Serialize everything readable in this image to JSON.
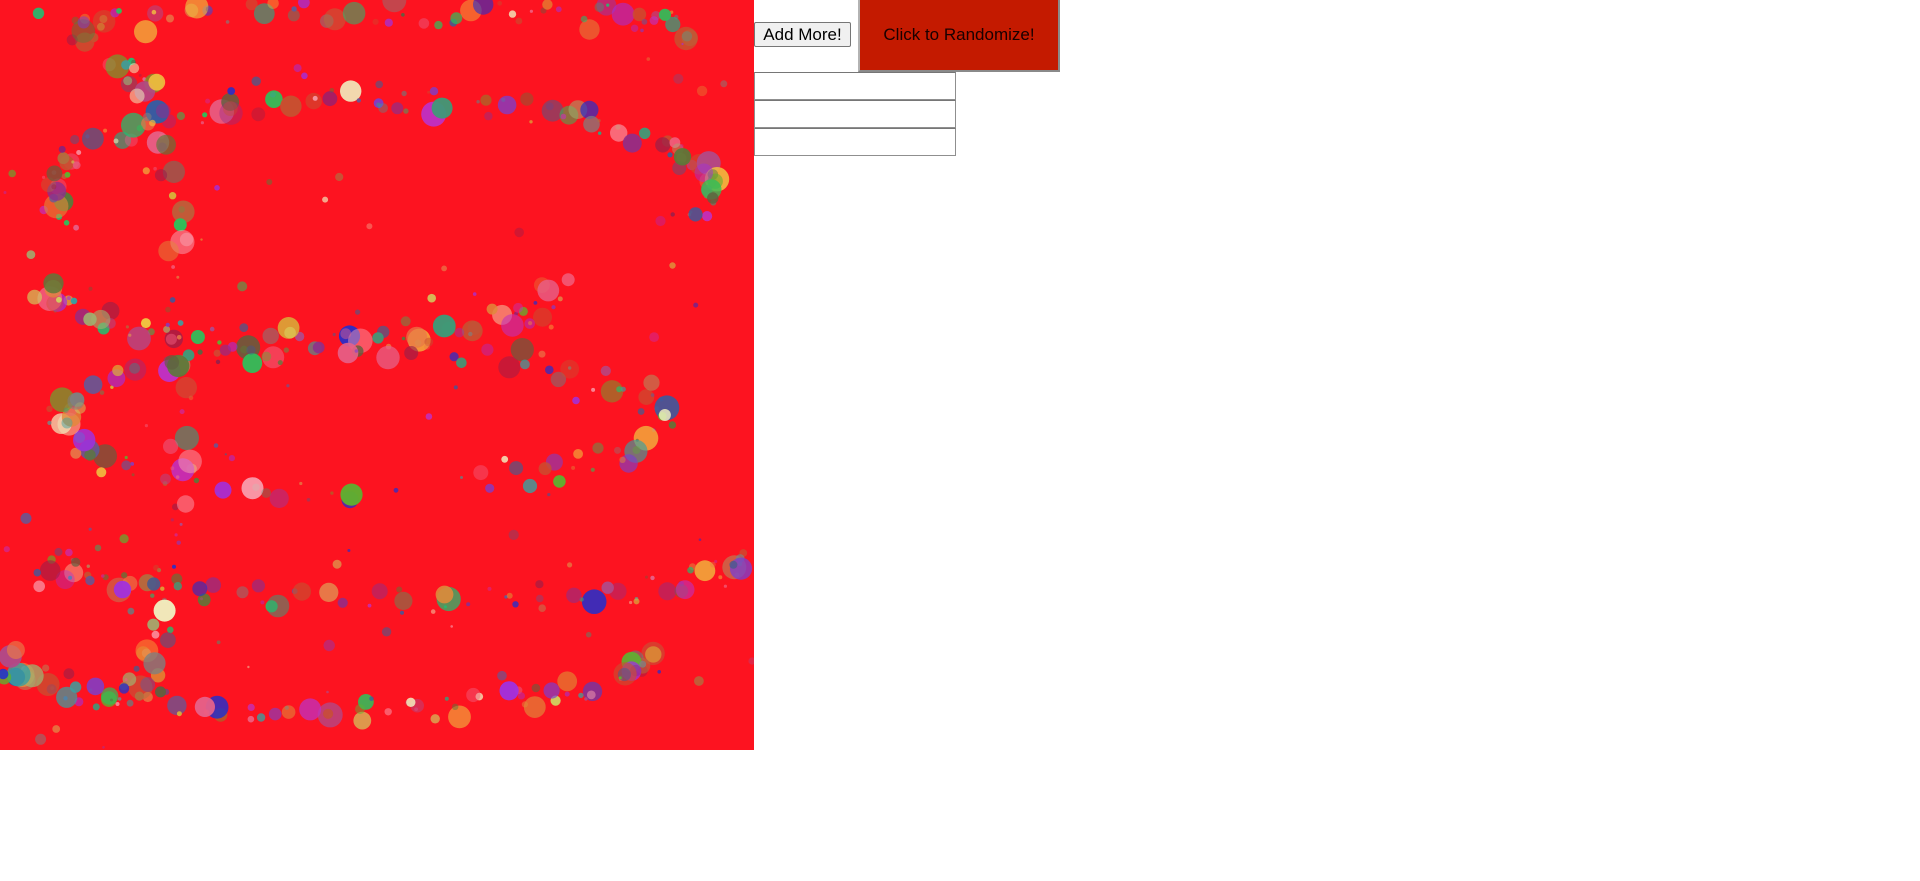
{
  "canvas": {
    "background_color": "#fd1320",
    "dot_palette": [
      "#8e2e8c",
      "#4b5a8c",
      "#2fbf5a",
      "#e08a3a",
      "#b04a8a",
      "#9a1f4a",
      "#3e9a78",
      "#d8b23a",
      "#e6628a",
      "#5c5c9e",
      "#7a3fd0",
      "#c85030",
      "#3aa0a0",
      "#a0b070",
      "#f06080",
      "#2030d0",
      "#f0c040",
      "#60b030",
      "#c030c0",
      "#5a7a3a",
      "#e87848",
      "#808080",
      "#3a5aa0",
      "#d0d060",
      "#f8a0b0",
      "#606040",
      "#b07040",
      "#20c070",
      "#a030e0",
      "#f0f0c0"
    ],
    "trail_count": 7
  },
  "controls": {
    "add_more_label": "Add More!",
    "randomize_label": "Click to Randomize!",
    "randomize_color": "#c41a00"
  },
  "inputs": [
    {
      "value": "",
      "placeholder": ""
    },
    {
      "value": "",
      "placeholder": ""
    },
    {
      "value": "",
      "placeholder": ""
    }
  ]
}
